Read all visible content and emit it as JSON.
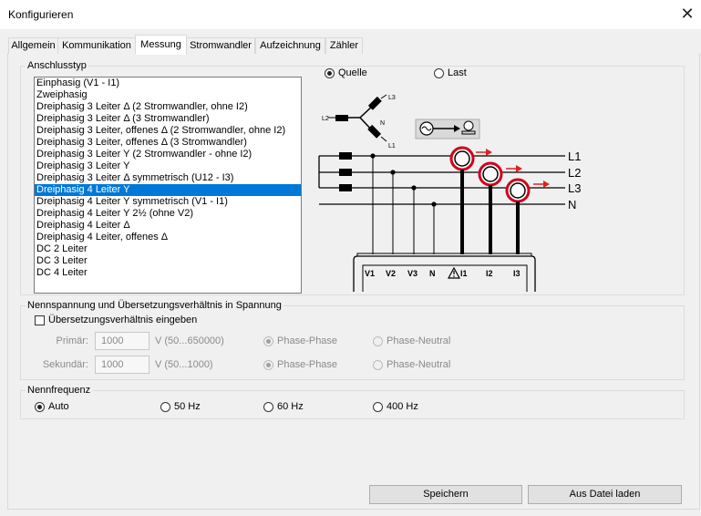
{
  "window": {
    "title": "Konfigurieren",
    "close_glyph": "✕"
  },
  "tabs": [
    {
      "label": "Allgemein"
    },
    {
      "label": "Kommunikation"
    },
    {
      "label": "Messung",
      "active": true
    },
    {
      "label": "Stromwandler"
    },
    {
      "label": "Aufzeichnung"
    },
    {
      "label": "Zähler"
    }
  ],
  "anschlusstyp": {
    "group_label": "Anschlusstyp",
    "items": [
      "Einphasig (V1 - I1)",
      "Zweiphasig",
      "Dreiphasig 3 Leiter Δ  (2 Stromwandler, ohne I2)",
      "Dreiphasig 3 Leiter Δ (3 Stromwandler)",
      "Dreiphasig 3 Leiter, offenes  Δ (2 Stromwandler, ohne I2)",
      "Dreiphasig 3 Leiter, offenes  Δ (3 Stromwandler)",
      "Dreiphasig 3 Leiter Y (2 Stromwandler - ohne I2)",
      "Dreiphasig 3 Leiter Y",
      "Dreiphasig 3 Leiter Δ symmetrisch (U12 - I3)",
      "Dreiphasig 4 Leiter Y",
      "Dreiphasig 4 Leiter Y symmetrisch (V1 - I1)",
      "Dreiphasig 4 Leiter Y 2½ (ohne V2)",
      "Dreiphasig 4 Leiter Δ",
      "Dreiphasig 4 Leiter, offenes  Δ",
      "DC 2 Leiter",
      "DC 3 Leiter",
      "DC 4 Leiter"
    ],
    "selected_index": 9,
    "source_radio": {
      "quelle": "Quelle",
      "last": "Last",
      "selected": "Quelle"
    }
  },
  "diagram": {
    "phase_labels": [
      "L1",
      "L2",
      "L3",
      "N"
    ],
    "star_labels": {
      "l1": "L1",
      "l2": "L2",
      "l3": "L3",
      "n": "N"
    },
    "terminals": [
      "V1",
      "V2",
      "V3",
      "N",
      "I1",
      "I2",
      "I3"
    ],
    "colors": {
      "clamp": "#d0021b",
      "arrow": "#e02020",
      "line": "#000000"
    }
  },
  "nennspannung": {
    "group_label": "Nennspannung und Übersetzungsverhältnis in Spannung",
    "checkbox_label": "Übersetzungsverhältnis eingeben",
    "checked": false,
    "rows": [
      {
        "label": "Primär:",
        "value": "1000",
        "range": "V (50...650000)",
        "opt1": "Phase-Phase",
        "opt2": "Phase-Neutral"
      },
      {
        "label": "Sekundär:",
        "value": "1000",
        "range": "V (50...1000)",
        "opt1": "Phase-Phase",
        "opt2": "Phase-Neutral"
      }
    ]
  },
  "nennfrequenz": {
    "group_label": "Nennfrequenz",
    "options": [
      "Auto",
      "50 Hz",
      "60 Hz",
      "400 Hz"
    ],
    "selected": "Auto"
  },
  "buttons": {
    "save": "Speichern",
    "load": "Aus Datei laden"
  },
  "accent_color": "#0078d7"
}
